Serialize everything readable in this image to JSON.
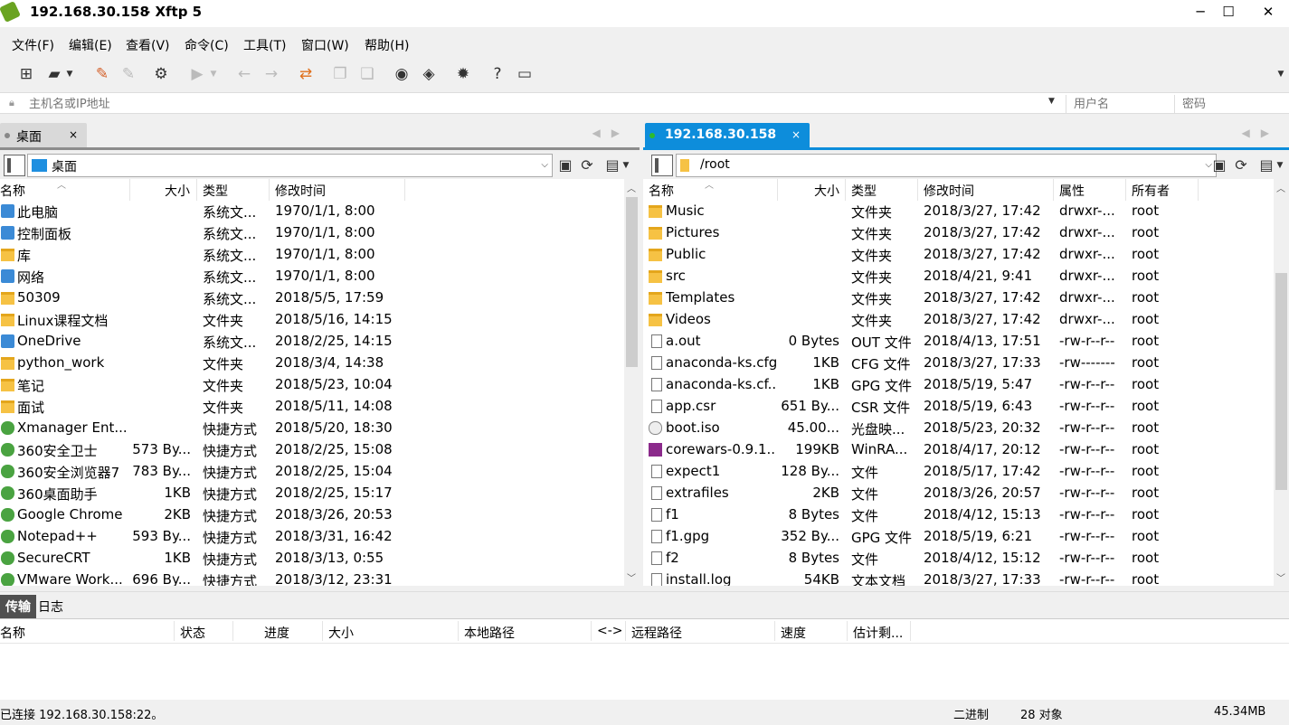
{
  "window": {
    "host": "192.168.30.158",
    "app_title": "- Xftp 5",
    "minimize": "─",
    "maximize": "☐",
    "close": "✕"
  },
  "menu": [
    "文件(F)",
    "编辑(E)",
    "查看(V)",
    "命令(C)",
    "工具(T)",
    "窗口(W)",
    "帮助(H)"
  ],
  "toolbar": {
    "icons": [
      "new-session-icon",
      "open-folder-icon",
      "dropdown-icon",
      "connect-icon",
      "disconnect-icon",
      "properties-icon",
      "view-icon",
      "dropdown-icon",
      "back-icon",
      "forward-icon",
      "transfer-icon",
      "copy-icon",
      "paste-icon",
      "xshell-icon",
      "xftp-icon",
      "settings-icon",
      "help-icon",
      "message-icon"
    ]
  },
  "address": {
    "host_placeholder": "主机名或IP地址",
    "user_placeholder": "用户名",
    "pass_placeholder": "密码"
  },
  "colors": {
    "accent": "#0d8ddb",
    "active_dot": "#2dbb2d",
    "inactive_tab": "#d9d9d9"
  },
  "left_pane": {
    "tab_label": "桌面",
    "tab_close": "×",
    "path": "桌面",
    "headers": [
      "名称",
      "大小",
      "类型",
      "修改时间"
    ],
    "rows": [
      {
        "icon": "sys",
        "name": "此电脑",
        "size": "",
        "type": "系统文...",
        "date": "1970/1/1, 8:00"
      },
      {
        "icon": "sys",
        "name": "控制面板",
        "size": "",
        "type": "系统文...",
        "date": "1970/1/1, 8:00"
      },
      {
        "icon": "folder",
        "name": "库",
        "size": "",
        "type": "系统文...",
        "date": "1970/1/1, 8:00"
      },
      {
        "icon": "sys",
        "name": "网络",
        "size": "",
        "type": "系统文...",
        "date": "1970/1/1, 8:00"
      },
      {
        "icon": "folder",
        "name": "50309",
        "size": "",
        "type": "系统文...",
        "date": "2018/5/5, 17:59"
      },
      {
        "icon": "folder",
        "name": "Linux课程文档",
        "size": "",
        "type": "文件夹",
        "date": "2018/5/16, 14:15"
      },
      {
        "icon": "sys",
        "name": "OneDrive",
        "size": "",
        "type": "系统文...",
        "date": "2018/2/25, 14:15"
      },
      {
        "icon": "folder",
        "name": "python_work",
        "size": "",
        "type": "文件夹",
        "date": "2018/3/4, 14:38"
      },
      {
        "icon": "folder",
        "name": "笔记",
        "size": "",
        "type": "文件夹",
        "date": "2018/5/23, 10:04"
      },
      {
        "icon": "folder",
        "name": "面试",
        "size": "",
        "type": "文件夹",
        "date": "2018/5/11, 14:08"
      },
      {
        "icon": "app",
        "name": "Xmanager Ent...",
        "size": "",
        "type": "快捷方式",
        "date": "2018/5/20, 18:30"
      },
      {
        "icon": "app",
        "name": "360安全卫士",
        "size": "573 By...",
        "type": "快捷方式",
        "date": "2018/2/25, 15:08"
      },
      {
        "icon": "app",
        "name": "360安全浏览器7",
        "size": "783 By...",
        "type": "快捷方式",
        "date": "2018/2/25, 15:04"
      },
      {
        "icon": "app",
        "name": "360桌面助手",
        "size": "1KB",
        "type": "快捷方式",
        "date": "2018/2/25, 15:17"
      },
      {
        "icon": "app",
        "name": "Google Chrome",
        "size": "2KB",
        "type": "快捷方式",
        "date": "2018/3/26, 20:53"
      },
      {
        "icon": "app",
        "name": "Notepad++",
        "size": "593 By...",
        "type": "快捷方式",
        "date": "2018/3/31, 16:42"
      },
      {
        "icon": "app",
        "name": "SecureCRT",
        "size": "1KB",
        "type": "快捷方式",
        "date": "2018/3/13, 0:55"
      },
      {
        "icon": "app",
        "name": "VMware Work...",
        "size": "696 By...",
        "type": "快捷方式",
        "date": "2018/3/12, 23:31"
      }
    ]
  },
  "right_pane": {
    "tab_label": "192.168.30.158",
    "tab_close": "×",
    "path": "/root",
    "headers": [
      "名称",
      "大小",
      "类型",
      "修改时间",
      "属性",
      "所有者"
    ],
    "rows": [
      {
        "icon": "folder",
        "name": "Music",
        "size": "",
        "type": "文件夹",
        "date": "2018/3/27, 17:42",
        "attr": "drwxr-...",
        "owner": "root"
      },
      {
        "icon": "folder",
        "name": "Pictures",
        "size": "",
        "type": "文件夹",
        "date": "2018/3/27, 17:42",
        "attr": "drwxr-...",
        "owner": "root"
      },
      {
        "icon": "folder",
        "name": "Public",
        "size": "",
        "type": "文件夹",
        "date": "2018/3/27, 17:42",
        "attr": "drwxr-...",
        "owner": "root"
      },
      {
        "icon": "folder",
        "name": "src",
        "size": "",
        "type": "文件夹",
        "date": "2018/4/21, 9:41",
        "attr": "drwxr-...",
        "owner": "root"
      },
      {
        "icon": "folder",
        "name": "Templates",
        "size": "",
        "type": "文件夹",
        "date": "2018/3/27, 17:42",
        "attr": "drwxr-...",
        "owner": "root"
      },
      {
        "icon": "folder",
        "name": "Videos",
        "size": "",
        "type": "文件夹",
        "date": "2018/3/27, 17:42",
        "attr": "drwxr-...",
        "owner": "root"
      },
      {
        "icon": "file",
        "name": "a.out",
        "size": "0 Bytes",
        "type": "OUT 文件",
        "date": "2018/4/13, 17:51",
        "attr": "-rw-r--r--",
        "owner": "root"
      },
      {
        "icon": "file",
        "name": "anaconda-ks.cfg",
        "size": "1KB",
        "type": "CFG 文件",
        "date": "2018/3/27, 17:33",
        "attr": "-rw-------",
        "owner": "root"
      },
      {
        "icon": "file",
        "name": "anaconda-ks.cf...",
        "size": "1KB",
        "type": "GPG 文件",
        "date": "2018/5/19, 5:47",
        "attr": "-rw-r--r--",
        "owner": "root"
      },
      {
        "icon": "file",
        "name": "app.csr",
        "size": "651 By...",
        "type": "CSR 文件",
        "date": "2018/5/19, 6:43",
        "attr": "-rw-r--r--",
        "owner": "root"
      },
      {
        "icon": "iso",
        "name": "boot.iso",
        "size": "45.00...",
        "type": "光盘映...",
        "date": "2018/5/23, 20:32",
        "attr": "-rw-r--r--",
        "owner": "root"
      },
      {
        "icon": "rar",
        "name": "corewars-0.9.1...",
        "size": "199KB",
        "type": "WinRA...",
        "date": "2018/4/17, 20:12",
        "attr": "-rw-r--r--",
        "owner": "root"
      },
      {
        "icon": "file",
        "name": "expect1",
        "size": "128 By...",
        "type": "文件",
        "date": "2018/5/17, 17:42",
        "attr": "-rw-r--r--",
        "owner": "root"
      },
      {
        "icon": "file",
        "name": "extrafiles",
        "size": "2KB",
        "type": "文件",
        "date": "2018/3/26, 20:57",
        "attr": "-rw-r--r--",
        "owner": "root"
      },
      {
        "icon": "file",
        "name": "f1",
        "size": "8 Bytes",
        "type": "文件",
        "date": "2018/4/12, 15:13",
        "attr": "-rw-r--r--",
        "owner": "root"
      },
      {
        "icon": "file",
        "name": "f1.gpg",
        "size": "352 By...",
        "type": "GPG 文件",
        "date": "2018/5/19, 6:21",
        "attr": "-rw-r--r--",
        "owner": "root"
      },
      {
        "icon": "file",
        "name": "f2",
        "size": "8 Bytes",
        "type": "文件",
        "date": "2018/4/12, 15:12",
        "attr": "-rw-r--r--",
        "owner": "root"
      },
      {
        "icon": "file",
        "name": "install.log",
        "size": "54KB",
        "type": "文本文档",
        "date": "2018/3/27, 17:33",
        "attr": "-rw-r--r--",
        "owner": "root"
      }
    ]
  },
  "bottom": {
    "tabs": [
      "传输",
      "日志"
    ],
    "headers": [
      "名称",
      "状态",
      "进度",
      "大小",
      "本地路径",
      "<->",
      "远程路径",
      "速度",
      "估计剩..."
    ]
  },
  "status": {
    "connection": "已连接 192.168.30.158:22。",
    "mode": "二进制",
    "objects": "28 对象",
    "size": "45.34MB"
  }
}
